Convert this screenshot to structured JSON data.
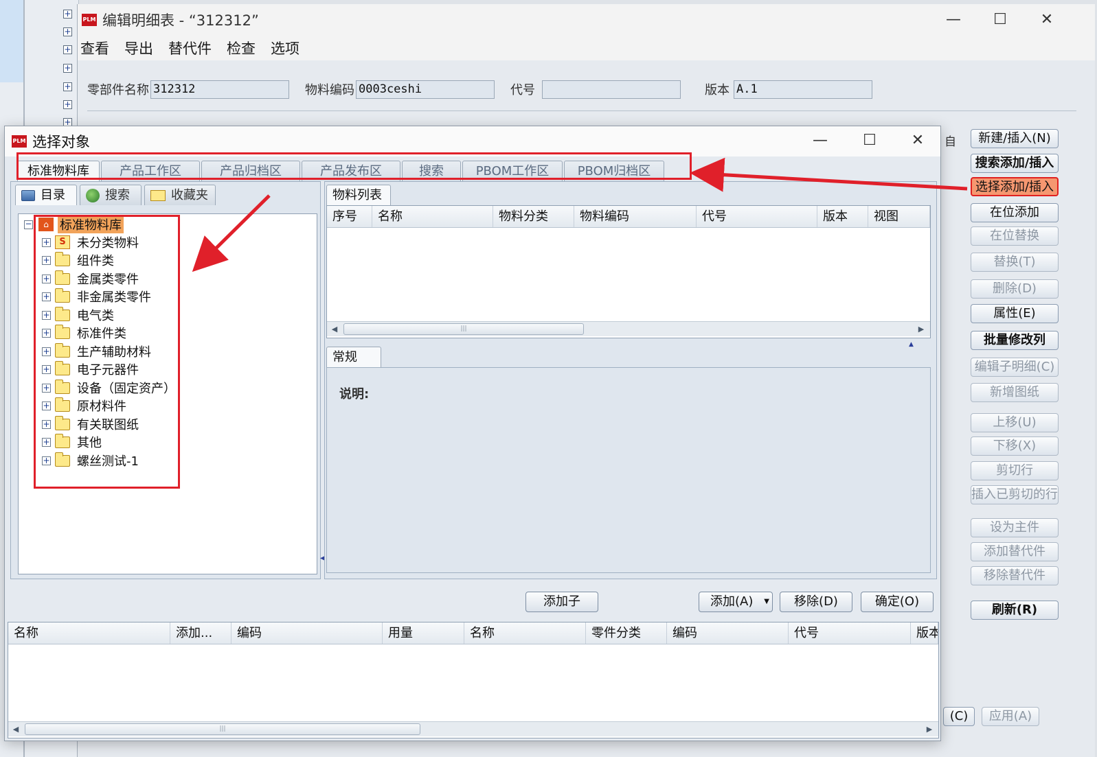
{
  "outer_window": {
    "title": "编辑明细表 - “312312”",
    "menu": [
      "查看",
      "导出",
      "替代件",
      "检查",
      "选项"
    ],
    "fields": {
      "part_name_label": "零部件名称",
      "part_name_value": "312312",
      "material_code_label": "物料编码",
      "material_code_value": "0003ceshi",
      "code_label": "代号",
      "code_value": "",
      "version_label": "版本",
      "version_value": "A.1"
    },
    "right_buttons": [
      {
        "label": "新建/插入(N)",
        "state": "enabled"
      },
      {
        "label": "搜索添加/插入",
        "state": "enabled"
      },
      {
        "label": "选择添加/插入",
        "state": "highlighted"
      },
      {
        "label": "在位添加",
        "state": "enabled"
      },
      {
        "label": "在位替换",
        "state": "disabled"
      },
      {
        "label": "替换(T)",
        "state": "disabled"
      },
      {
        "label": "删除(D)",
        "state": "disabled"
      },
      {
        "label": "属性(E)",
        "state": "enabled"
      },
      {
        "label": "批量修改列",
        "state": "enabled"
      },
      {
        "label": "编辑子明细(C)",
        "state": "disabled"
      },
      {
        "label": "新增图纸",
        "state": "disabled"
      },
      {
        "label": "上移(U)",
        "state": "disabled"
      },
      {
        "label": "下移(X)",
        "state": "disabled"
      },
      {
        "label": "剪切行",
        "state": "disabled"
      },
      {
        "label": "插入已剪切的行",
        "state": "disabled"
      },
      {
        "label": "设为主件",
        "state": "disabled"
      },
      {
        "label": "添加替代件",
        "state": "disabled"
      },
      {
        "label": "移除替代件",
        "state": "disabled"
      },
      {
        "label": "刷新(R)",
        "state": "enabled"
      }
    ],
    "bottom_buttons": {
      "cancel_partial": "(C)",
      "apply": "应用(A)"
    },
    "bg_header_partial": "自"
  },
  "dialog": {
    "title": "选择对象",
    "tabs": [
      "标准物料库",
      "产品工作区",
      "产品归档区",
      "产品发布区",
      "搜索",
      "PBOM工作区",
      "PBOM归档区"
    ],
    "active_tab": "标准物料库",
    "left_subtabs": [
      "目录",
      "搜索",
      "收藏夹"
    ],
    "tree": {
      "root": "标准物料库",
      "children": [
        "未分类物料",
        "组件类",
        "金属类零件",
        "非金属类零件",
        "电气类",
        "标准件类",
        "生产辅助材料",
        "电子元器件",
        "设备（固定资产）",
        "原材料件",
        "有关联图纸",
        "其他",
        "螺丝测试-1"
      ]
    },
    "material_list_tab": "物料列表",
    "material_columns": [
      "序号",
      "名称",
      "物料分类",
      "物料编码",
      "代号",
      "版本",
      "视图"
    ],
    "detail_tab": "常规",
    "description_label": "说明:",
    "buttons": {
      "add_child": "添加子",
      "add": "添加(A)",
      "remove": "移除(D)",
      "ok": "确定(O)"
    },
    "selected_columns": [
      "名称",
      "添加...",
      "编码",
      "用量",
      "名称",
      "零件分类",
      "编码",
      "代号",
      "版本"
    ]
  },
  "colors": {
    "accent_red": "#e0202a",
    "highlight_button": "#f59770",
    "tree_root_highlight": "#f2a35a"
  }
}
